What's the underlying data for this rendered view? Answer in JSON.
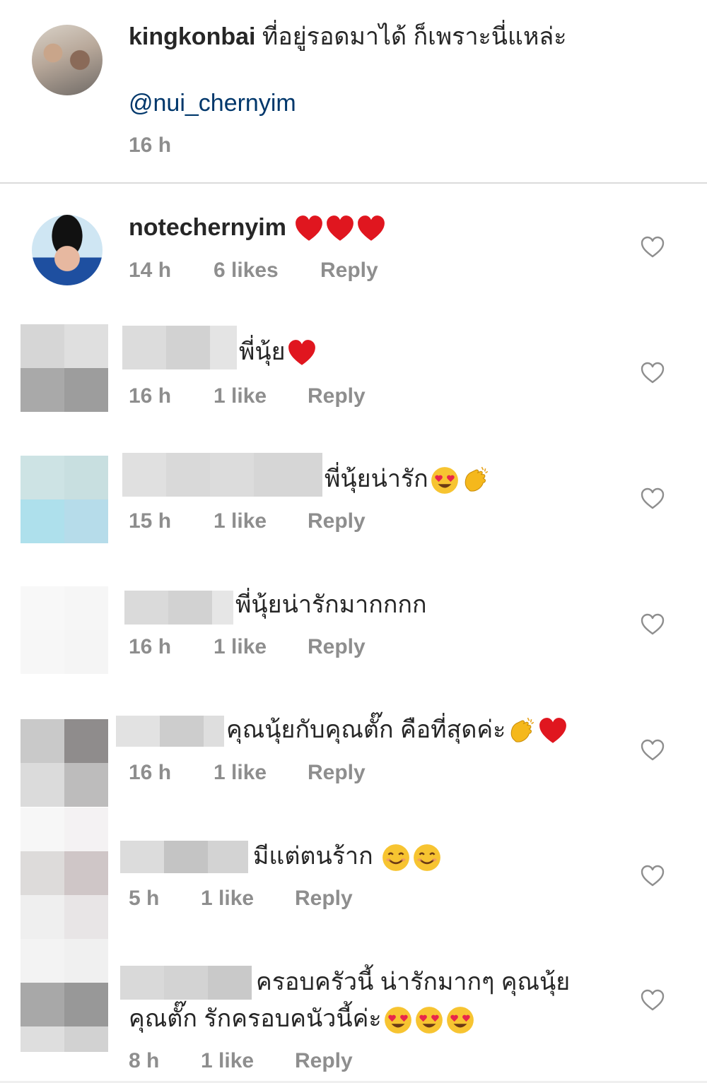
{
  "caption": {
    "username": "kingkonbai",
    "text": "ที่อยู่รอดมาได้ ก็เพราะนี่แหล่ะ",
    "mention": "@nui_chernyim",
    "time": "16 h"
  },
  "comments": [
    {
      "username": "notechernyim",
      "text": "",
      "emoji": [
        "red-heart",
        "red-heart",
        "red-heart"
      ],
      "time": "14 h",
      "likes": "6 likes",
      "reply": "Reply"
    },
    {
      "username": "",
      "text": "พี่นุ้ย",
      "emoji": [
        "red-heart"
      ],
      "time": "16 h",
      "likes": "1 like",
      "reply": "Reply"
    },
    {
      "username": "",
      "text": "พี่นุ้ยน่ารัก",
      "emoji": [
        "heart-eyes",
        "clapping-hands"
      ],
      "time": "15 h",
      "likes": "1 like",
      "reply": "Reply"
    },
    {
      "username": "",
      "text": "พี่นุ้ยน่ารักมากกกก",
      "emoji": [],
      "time": "16 h",
      "likes": "1 like",
      "reply": "Reply"
    },
    {
      "username": "",
      "text": "คุณนุ้ยกับคุณตั๊ก คือที่สุดค่ะ",
      "emoji": [
        "clapping-hands",
        "red-heart"
      ],
      "time": "16 h",
      "likes": "1 like",
      "reply": "Reply"
    },
    {
      "username": "",
      "text": "มีแต่ตนร้าก ",
      "emoji": [
        "smiling-face",
        "smiling-face"
      ],
      "time": "5 h",
      "likes": "1 like",
      "reply": "Reply"
    },
    {
      "username": "",
      "text": "ครอบครัวนี้ น่ารักมากๆ คุณนุ้ย",
      "text2": "คุณตั๊ก  รักครอบคนัวนี้ค่ะ",
      "emoji": [
        "heart-eyes",
        "heart-eyes",
        "heart-eyes"
      ],
      "time": "8 h",
      "likes": "1 like",
      "reply": "Reply"
    }
  ],
  "colors": {
    "text": "#262626",
    "meta": "#8e8e8e",
    "mention": "#00376b",
    "heart": "#e0161f"
  }
}
